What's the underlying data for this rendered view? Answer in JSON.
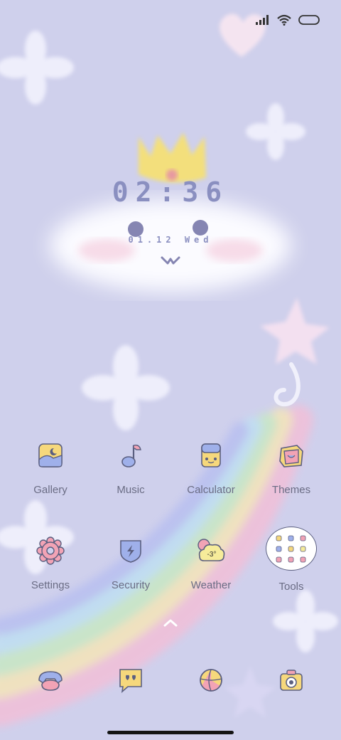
{
  "status_bar": {
    "icons": [
      "signal-icon",
      "wifi-icon",
      "battery-icon"
    ]
  },
  "clock": {
    "time": "02:36",
    "date": "01.12 Wed"
  },
  "apps": [
    {
      "label": "Gallery",
      "icon": "gallery-icon"
    },
    {
      "label": "Music",
      "icon": "music-icon"
    },
    {
      "label": "Calculator",
      "icon": "calculator-icon"
    },
    {
      "label": "Themes",
      "icon": "themes-icon"
    },
    {
      "label": "Settings",
      "icon": "settings-icon"
    },
    {
      "label": "Security",
      "icon": "security-icon"
    },
    {
      "label": "Weather",
      "icon": "weather-icon",
      "temperature": "-3°"
    },
    {
      "label": "Tools",
      "icon": "tools-folder-icon"
    }
  ],
  "dock": {
    "icons": [
      "phone-icon",
      "messaging-icon",
      "browser-icon",
      "camera-icon"
    ]
  },
  "colors": {
    "background": "#cfd0ec",
    "label": "#6a6c84",
    "clock": "#8a8fc0",
    "outline": "#5b5f80"
  }
}
